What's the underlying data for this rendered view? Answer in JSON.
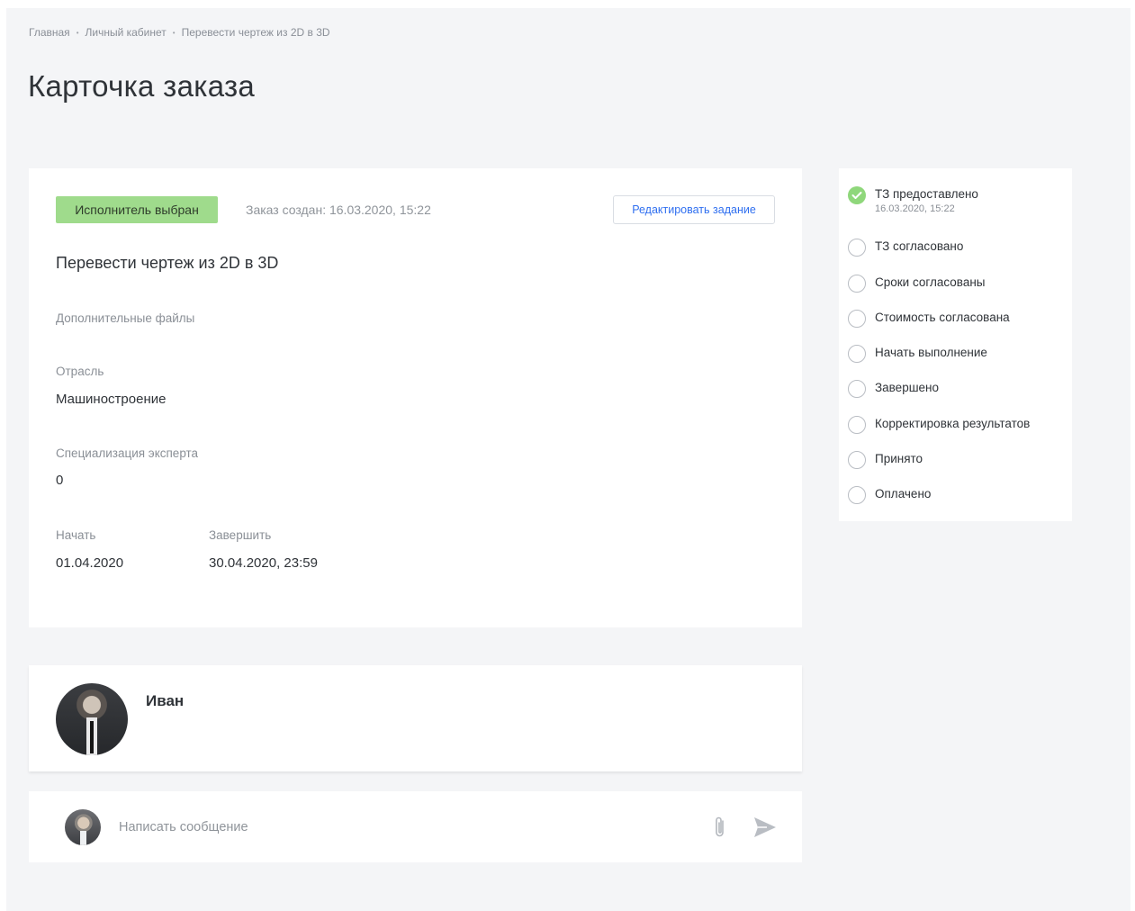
{
  "breadcrumb": {
    "home": "Главная",
    "cabinet": "Личный кабинет",
    "current": "Перевести чертеж из 2D в 3D",
    "separator": "•"
  },
  "page_title": "Карточка заказа",
  "order": {
    "status_badge": "Исполнитель выбран",
    "created": "Заказ создан: 16.03.2020, 15:22",
    "edit_button": "Редактировать задание",
    "title": "Перевести чертеж из 2D в 3D",
    "files_label": "Дополнительные файлы",
    "industry_label": "Отрасль",
    "industry_value": "Машиностроение",
    "specialization_label": "Специализация эксперта",
    "specialization_value": "0",
    "start_label": "Начать",
    "start_value": "01.04.2020",
    "end_label": "Завершить",
    "end_value": "30.04.2020, 23:59"
  },
  "executor": {
    "name": "Иван",
    "avatar_icon": "user-photo"
  },
  "message": {
    "placeholder": "Написать сообщение",
    "attach_icon": "paperclip-icon",
    "send_icon": "send-icon"
  },
  "statuses": [
    {
      "label": "ТЗ предоставлено",
      "date": "16.03.2020, 15:22",
      "done": true
    },
    {
      "label": "ТЗ согласовано",
      "done": false
    },
    {
      "label": "Сроки согласованы",
      "done": false
    },
    {
      "label": "Стоимость согласована",
      "done": false
    },
    {
      "label": "Начать выполнение",
      "done": false
    },
    {
      "label": "Завершено",
      "done": false
    },
    {
      "label": "Корректировка результатов",
      "done": false
    },
    {
      "label": "Принято",
      "done": false
    },
    {
      "label": "Оплачено",
      "done": false
    }
  ],
  "colors": {
    "page_bg": "#f4f5f7",
    "badge_bg": "#9fdb8c",
    "done_check": "#8fd77b",
    "link_blue": "#2f6ff0"
  }
}
